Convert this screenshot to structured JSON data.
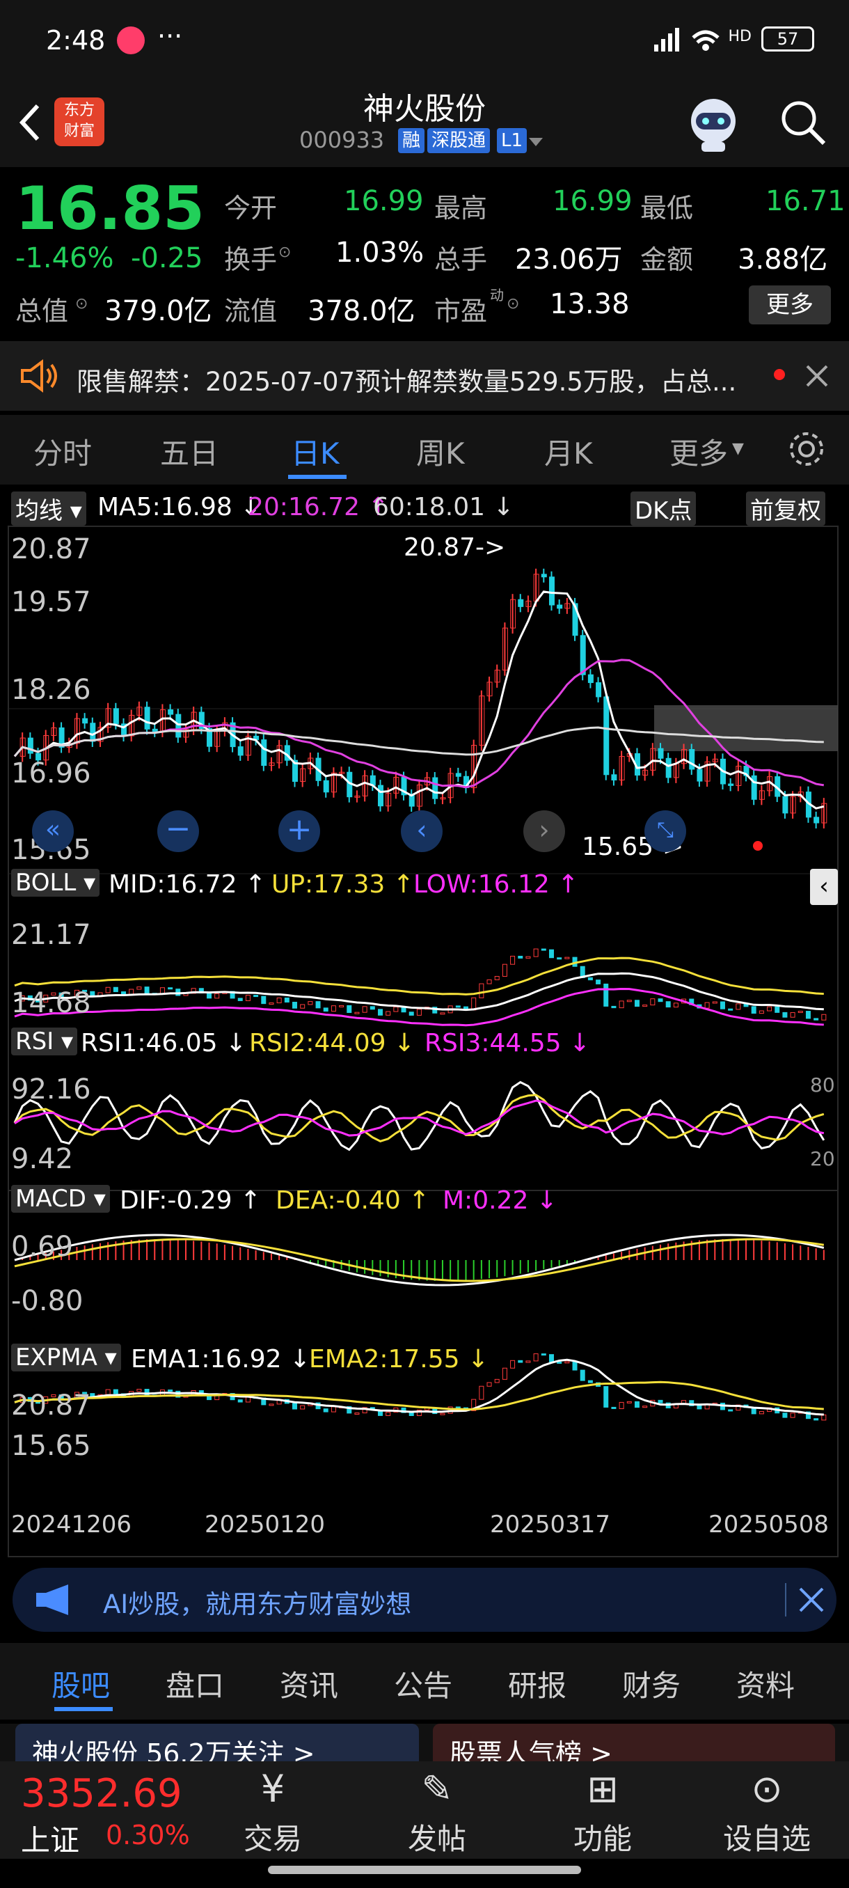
{
  "status": {
    "time": "2:48",
    "extra": "···",
    "battery": "57",
    "signal_label": "HD"
  },
  "header": {
    "logo": "东方\n财富",
    "title": "神火股份",
    "code": "000933",
    "tags": [
      "融",
      "深股通",
      "L1"
    ]
  },
  "quote": {
    "price": "16.85",
    "change_pct": "-1.46%",
    "change": "-0.25",
    "open_label": "今开",
    "open": "16.99",
    "high_label": "最高",
    "high": "16.99",
    "low_label": "最低",
    "low": "16.71",
    "turnover_label": "换手",
    "turnover": "1.03%",
    "volume_label": "总手",
    "volume": "23.06万",
    "amount_label": "金额",
    "amount": "3.88亿",
    "mcap_label": "总值",
    "mcap": "379.0亿",
    "float_label": "流值",
    "float": "378.0亿",
    "pe_label": "市盈",
    "pe_sup": "动",
    "pe": "13.38",
    "more": "更多"
  },
  "notice": {
    "text": "限售解禁：2025-07-07预计解禁数量529.5万股，占总..."
  },
  "ktabs": [
    "分时",
    "五日",
    "日K",
    "周K",
    "月K",
    "更多"
  ],
  "chart": {
    "ma": {
      "chip": "均线",
      "ma5": "MA5:16.98 ↓",
      "ma20": "20:16.72 ↑",
      "ma60": "60:18.01 ↓",
      "dk": "DK点",
      "adj": "前复权"
    },
    "price_axis": [
      "20.87",
      "19.57",
      "18.26",
      "16.96",
      "15.65"
    ],
    "max_label": "20.87->",
    "min_label": "15.65->",
    "boll": {
      "chip": "BOLL",
      "mid": "MID:16.72 ↑",
      "up": "UP:17.33 ↑",
      "low": "LOW:16.12 ↑",
      "axis": [
        "21.17",
        "14.68"
      ]
    },
    "rsi": {
      "chip": "RSI",
      "r1": "RSI1:46.05 ↓",
      "r2": "RSI2:44.09 ↓",
      "r3": "RSI3:44.55 ↓",
      "axis": [
        "92.16",
        "9.42"
      ],
      "right": [
        "80",
        "20"
      ]
    },
    "macd": {
      "chip": "MACD",
      "dif": "DIF:-0.29 ↑",
      "dea": "DEA:-0.40 ↑",
      "m": "M:0.22 ↓",
      "axis": [
        "0.69",
        "-0.80"
      ]
    },
    "expma": {
      "chip": "EXPMA",
      "e1": "EMA1:16.92 ↓",
      "e2": "EMA2:17.55 ↓",
      "axis": [
        "20.87",
        "15.65"
      ]
    },
    "dates": [
      "20241206",
      "20250120",
      "20250317",
      "20250508"
    ],
    "colors": {
      "up": "#ff3b3b",
      "down": "#1fd0e0",
      "ma5": "#ffffff",
      "ma20": "#e040e0",
      "ma60": "#dddddd",
      "yellow": "#f5e03a",
      "magenta": "#ff30ff"
    }
  },
  "ai": {
    "text": "AI炒股，就用东方财富妙想"
  },
  "btabs": [
    "股吧",
    "盘口",
    "资讯",
    "公告",
    "研报",
    "财务",
    "资料"
  ],
  "cards": {
    "c1": "神火股份 56.2万关注 >",
    "c2": "股票人气榜 >"
  },
  "dock": {
    "index": "3352.69",
    "market": "上证",
    "pct": "0.30%",
    "items": [
      {
        "icon": "yen-icon",
        "label": "交易"
      },
      {
        "icon": "edit-icon",
        "label": "发帖"
      },
      {
        "icon": "grid-icon",
        "label": "功能"
      },
      {
        "icon": "more-icon",
        "label": "设自选"
      }
    ]
  }
}
